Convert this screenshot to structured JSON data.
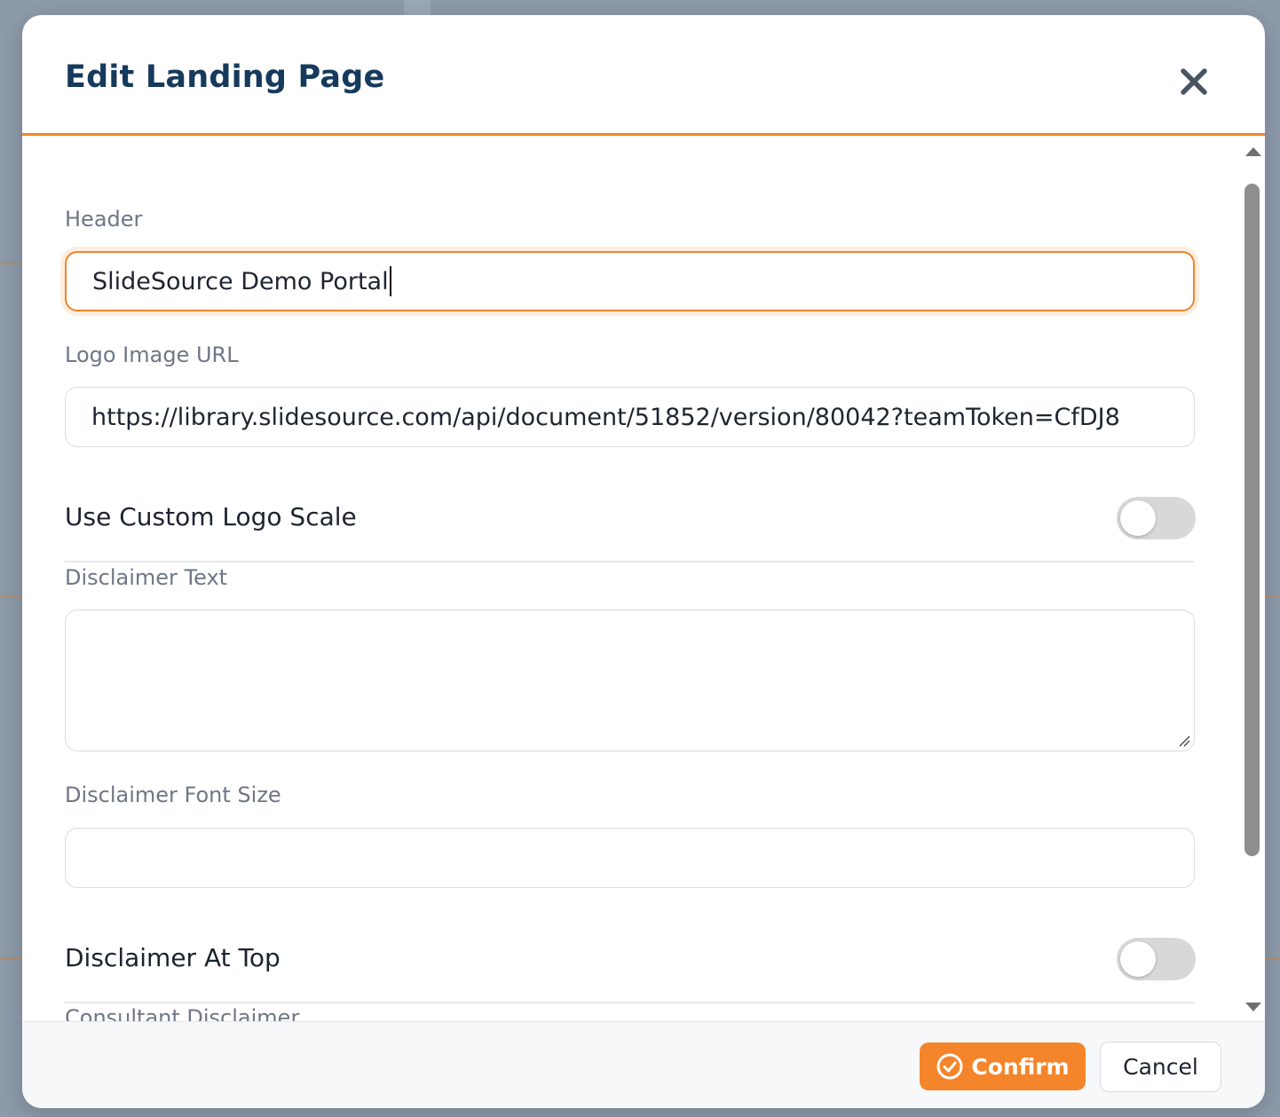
{
  "modal": {
    "title": "Edit Landing Page"
  },
  "fields": {
    "header": {
      "label": "Header",
      "value": "SlideSource Demo Portal"
    },
    "logo_url": {
      "label": "Logo Image URL",
      "value": "https://library.slidesource.com/api/document/51852/version/80042?teamToken=CfDJ8"
    },
    "custom_logo_scale": {
      "label": "Use Custom Logo Scale",
      "enabled": false
    },
    "disclaimer_text": {
      "label": "Disclaimer Text",
      "value": ""
    },
    "disclaimer_font_size": {
      "label": "Disclaimer Font Size",
      "value": ""
    },
    "disclaimer_at_top": {
      "label": "Disclaimer At Top",
      "enabled": false
    },
    "consultant_disclaimer": {
      "label": "Consultant Disclaimer"
    }
  },
  "footer": {
    "confirm_label": "Confirm",
    "cancel_label": "Cancel"
  },
  "colors": {
    "accent": "#f0862a",
    "title": "#163a5c",
    "label": "#6f7687",
    "toggle_off": "#d8d8d8"
  },
  "icons": {
    "close": "close-icon",
    "confirm": "check-circle-icon"
  }
}
